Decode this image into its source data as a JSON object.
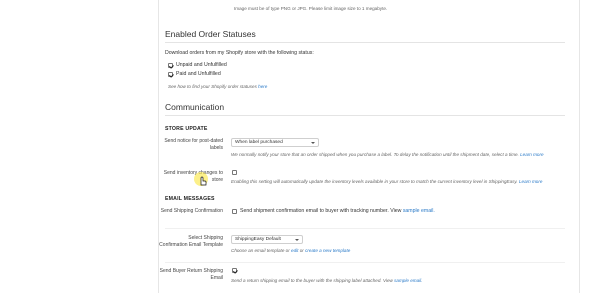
{
  "top_note": "Image must be of type PNG or JPG. Please limit image size to 1 megabyte.",
  "order_statuses": {
    "heading": "Enabled Order Statuses",
    "description": "Download orders from my Shopify store with the following status:",
    "options": [
      {
        "label": "Unpaid and Unfulfilled",
        "checked": true
      },
      {
        "label": "Paid and Unfulfilled",
        "checked": true
      }
    ],
    "help_prefix": "See how to find your Shopify order statuses",
    "help_link": "here"
  },
  "communication": {
    "heading": "Communication",
    "store_update": {
      "heading": "STORE UPDATE",
      "notify_label": "Send notice for post-dated labels",
      "notify_select": "When label purchased",
      "notify_help": "We normally notify your store that an order shipped when you purchase a label. To delay the notification until the shipment date, select a time.",
      "notify_help_link": "Learn more",
      "inventory_label": "Send inventory changes to store",
      "inventory_checked": false,
      "inventory_help": "Enabling this setting will automatically update the inventory levels available in your store to match the current inventory level in ShippingEasy.",
      "inventory_help_link": "Learn more"
    },
    "email_messages": {
      "heading": "EMAIL MESSAGES",
      "confirm_label": "Send Shipping Confirmation",
      "confirm_checked": false,
      "confirm_text": "Send shipment confirmation email to buyer with tracking number. View",
      "confirm_link": "sample email.",
      "template_label": "Select Shipping Confirmation Email Template",
      "template_select": "ShippingEasy Default",
      "template_help_prefix": "Choose an email template",
      "template_help_mid": "or",
      "template_help_link1": "edit",
      "template_help_or": "or",
      "template_help_link2": "create a new template",
      "return_label": "Send Buyer Return Shipping Email",
      "return_checked": true,
      "return_text": "Send a return shipping email to the buyer with the shipping label attached. View",
      "return_link": "sample email."
    }
  }
}
